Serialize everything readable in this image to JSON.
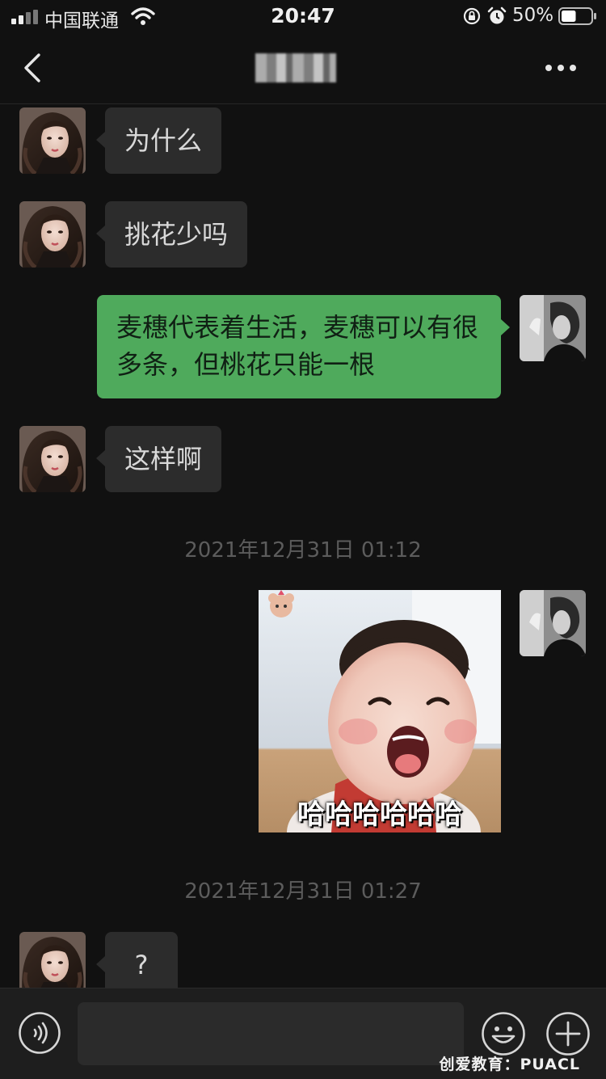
{
  "status_bar": {
    "carrier": "中国联通",
    "time": "20:47",
    "battery_percent": "50%",
    "battery_level": 0.5
  },
  "nav": {
    "title": "",
    "back_icon": "chevron-left-icon",
    "more_icon": "ellipsis-icon"
  },
  "messages": [
    {
      "side": "in",
      "text": "为什么"
    },
    {
      "side": "in",
      "text": "挑花少吗"
    },
    {
      "side": "out",
      "text": "麦穗代表着生活，麦穗可以有很多条，但桃花只能一根"
    },
    {
      "side": "in",
      "text": "这样啊"
    },
    {
      "type": "timestamp",
      "text": "2021年12月31日 01:12"
    },
    {
      "side": "out",
      "type": "sticker",
      "caption": "哈哈哈哈哈哈"
    },
    {
      "type": "timestamp",
      "text": "2021年12月31日 01:27"
    },
    {
      "side": "in",
      "text": "?"
    }
  ],
  "input_bar": {
    "placeholder": "",
    "voice_icon": "voice-icon",
    "emoji_icon": "emoji-icon",
    "plus_icon": "plus-icon"
  },
  "watermark": "创爱教育：PUACL",
  "colors": {
    "background": "#111111",
    "incoming_bubble": "#2c2c2c",
    "outgoing_bubble": "#4faa5c",
    "timestamp_text": "#5c5c5c"
  }
}
